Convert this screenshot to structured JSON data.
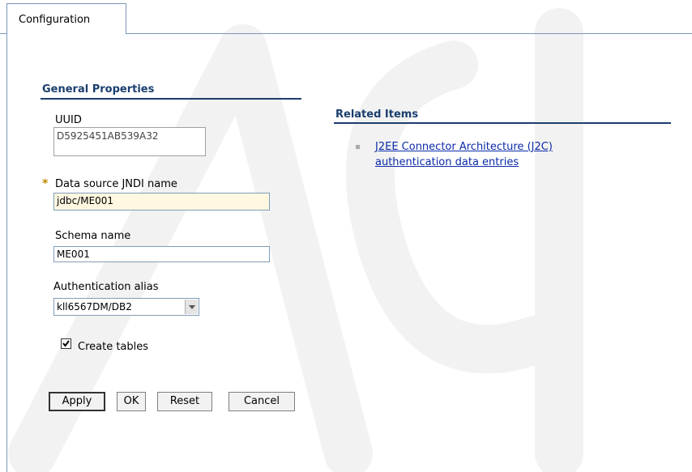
{
  "tabs": [
    {
      "label": "Configuration"
    }
  ],
  "general": {
    "title": "General Properties",
    "uuid_label": "UUID",
    "uuid_value": "D5925451AB539A32",
    "jndi_label": "Data source JNDI name",
    "jndi_value": "jdbc/ME001",
    "schema_label": "Schema name",
    "schema_value": "ME001",
    "auth_label": "Authentication alias",
    "auth_value": "kll6567DM/DB2",
    "create_tables_label": "Create tables",
    "create_tables_checked": true
  },
  "buttons": {
    "apply": "Apply",
    "ok": "OK",
    "reset": "Reset",
    "cancel": "Cancel"
  },
  "related": {
    "title": "Related Items",
    "link_line1": "J2EE Connector Architecture (J2C)",
    "link_line2": "authentication data entries"
  },
  "colors": {
    "section": "#1a3e6e",
    "link": "#0b2aa8",
    "required_bg": "#fff8e0"
  }
}
